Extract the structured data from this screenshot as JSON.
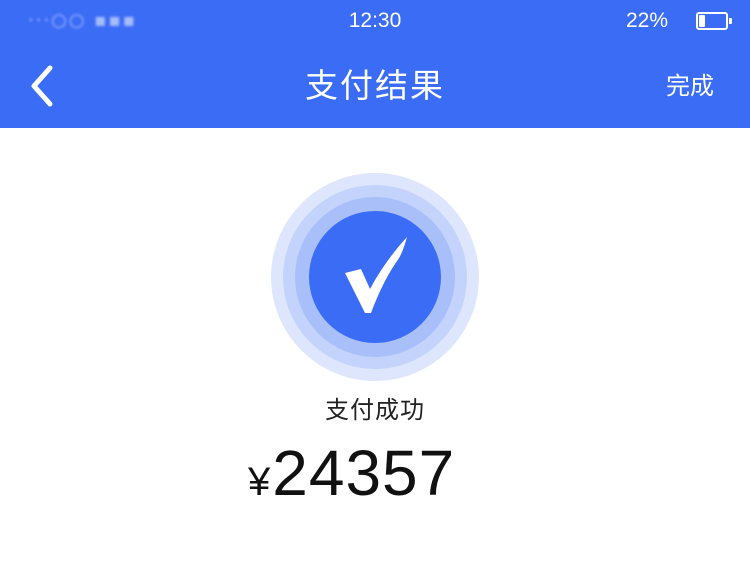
{
  "status_bar": {
    "carrier": "···○○ ▪▪▪",
    "time": "12:30",
    "battery_percent": "22%"
  },
  "nav": {
    "title": "支付结果",
    "back_icon": "chevron-left-icon",
    "done_label": "完成"
  },
  "result": {
    "icon": "check-circle-icon",
    "status_text": "支付成功",
    "currency_symbol": "¥",
    "amount": "24357"
  },
  "colors": {
    "primary": "#3b6cf6",
    "ring_outer": "#dde6fd",
    "ring_mid": "#a9bffa",
    "ring_inner": "#7a9cf7",
    "text_dark": "#111111",
    "background": "#ffffff"
  }
}
